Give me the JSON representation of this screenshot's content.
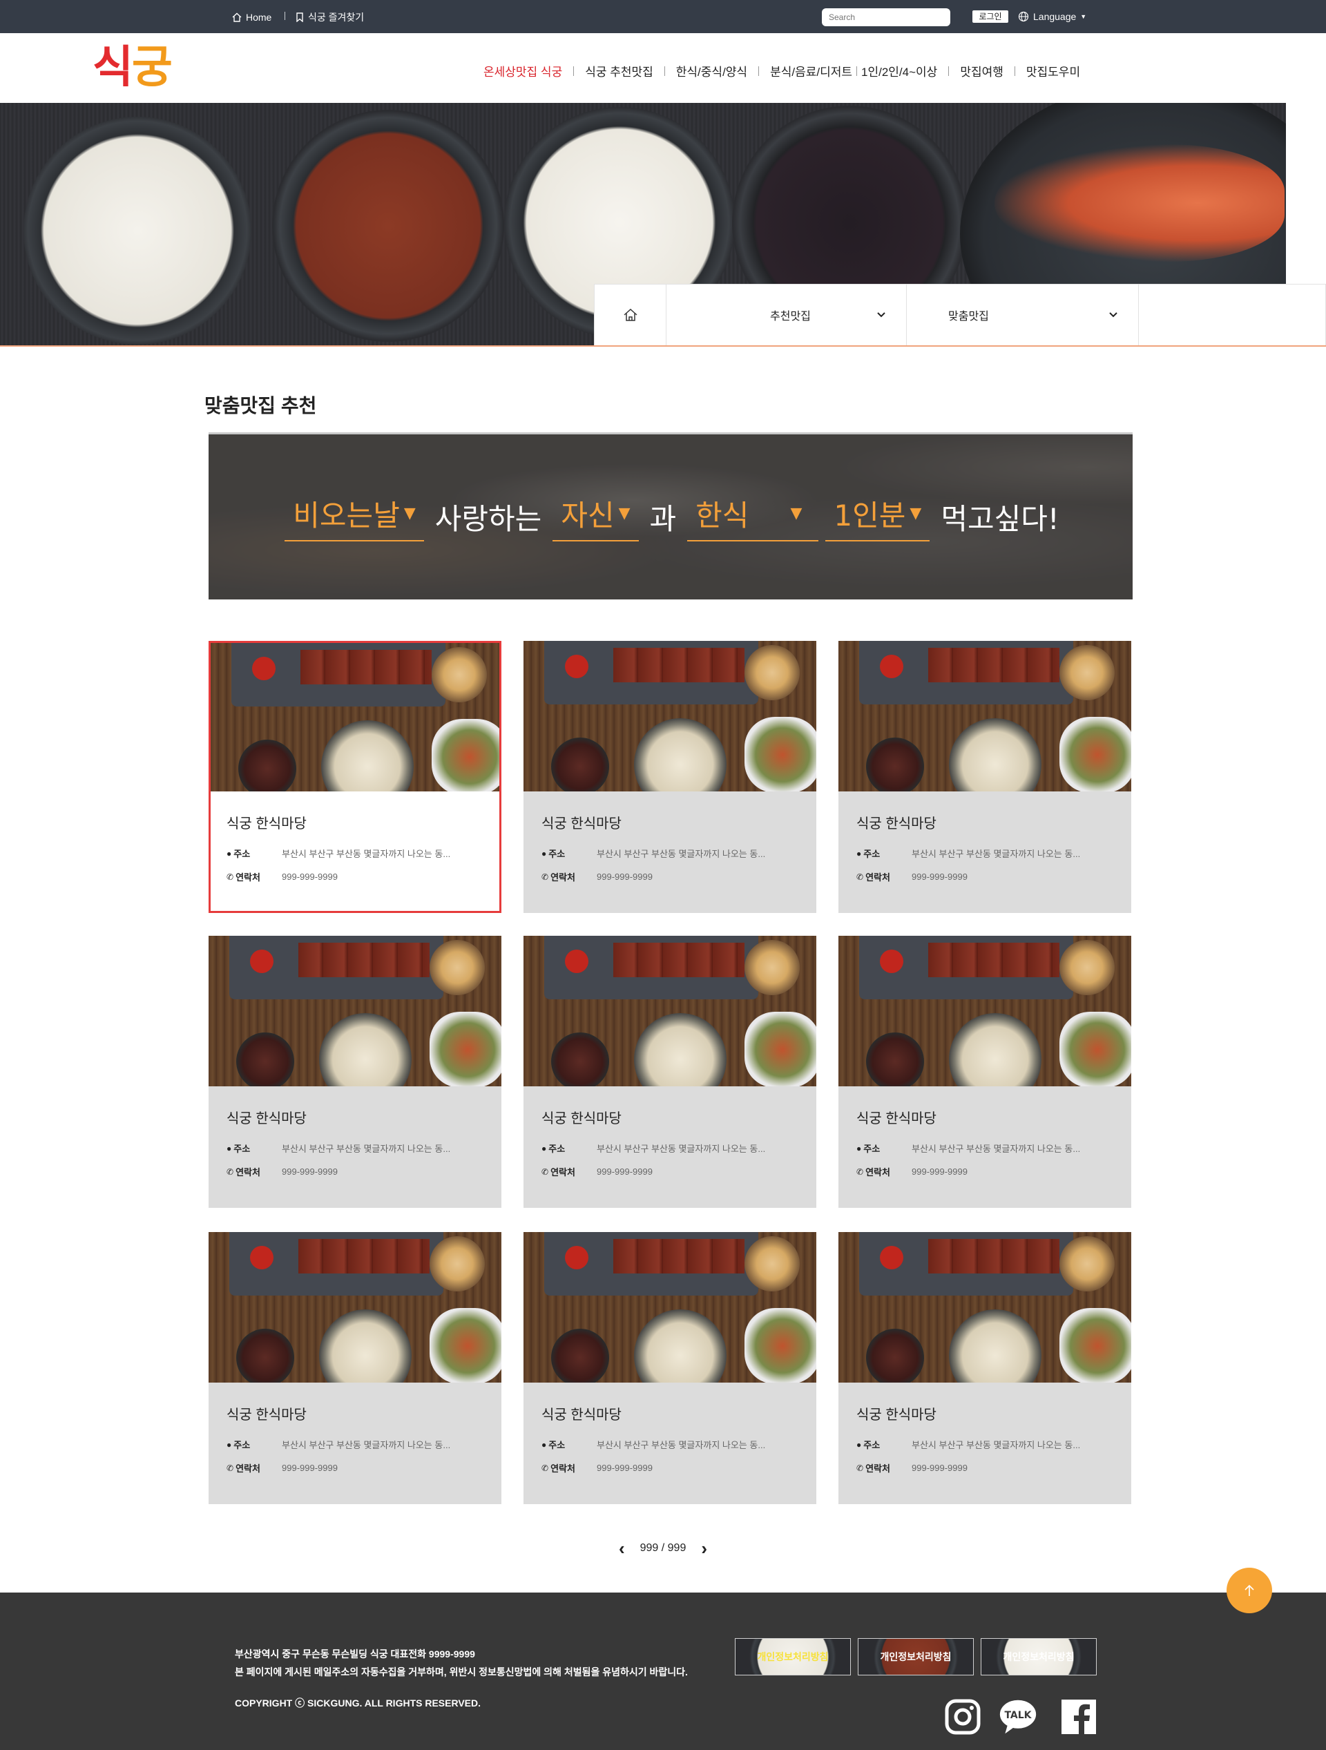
{
  "topbar": {
    "home_label": "Home",
    "favorite_label": "식궁 즐겨찾기",
    "search_placeholder": "Search",
    "login_label": "로그인",
    "language_label": "Language"
  },
  "header": {
    "logo_part1": "식",
    "logo_part2": "궁",
    "nav": [
      {
        "label": "온세상맛집 식궁",
        "active": true
      },
      {
        "label": "식궁 추천맛집"
      },
      {
        "label": "한식/중식/양식"
      },
      {
        "label": "분식/음료/디저트"
      },
      {
        "label": "1인/2인/4~이상"
      },
      {
        "label": "맛집여행"
      },
      {
        "label": "맛집도우미"
      }
    ]
  },
  "subbar": {
    "dropdown1": "추천맛집",
    "dropdown2": "맞춤맛집"
  },
  "section": {
    "title": "맞춤맛집 추천"
  },
  "selector": {
    "weather": "비오는날",
    "word1": "사랑하는",
    "companion": "자신",
    "word2": "과",
    "food": "한식",
    "people": "1인분",
    "ending": "먹고싶다!"
  },
  "cards": [
    {
      "name": "식궁 한식마당",
      "addr_label": "주소",
      "addr": "부산시 부산구 부산동 몇글자까지 나오는 동...",
      "tel_label": "연락처",
      "tel": "999-999-9999",
      "selected": true
    },
    {
      "name": "식궁 한식마당",
      "addr_label": "주소",
      "addr": "부산시 부산구 부산동 몇글자까지 나오는 동...",
      "tel_label": "연락처",
      "tel": "999-999-9999"
    },
    {
      "name": "식궁 한식마당",
      "addr_label": "주소",
      "addr": "부산시 부산구 부산동 몇글자까지 나오는 동...",
      "tel_label": "연락처",
      "tel": "999-999-9999"
    },
    {
      "name": "식궁 한식마당",
      "addr_label": "주소",
      "addr": "부산시 부산구 부산동 몇글자까지 나오는 동...",
      "tel_label": "연락처",
      "tel": "999-999-9999"
    },
    {
      "name": "식궁 한식마당",
      "addr_label": "주소",
      "addr": "부산시 부산구 부산동 몇글자까지 나오는 동...",
      "tel_label": "연락처",
      "tel": "999-999-9999"
    },
    {
      "name": "식궁 한식마당",
      "addr_label": "주소",
      "addr": "부산시 부산구 부산동 몇글자까지 나오는 동...",
      "tel_label": "연락처",
      "tel": "999-999-9999"
    },
    {
      "name": "식궁 한식마당",
      "addr_label": "주소",
      "addr": "부산시 부산구 부산동 몇글자까지 나오는 동...",
      "tel_label": "연락처",
      "tel": "999-999-9999"
    },
    {
      "name": "식궁 한식마당",
      "addr_label": "주소",
      "addr": "부산시 부산구 부산동 몇글자까지 나오는 동...",
      "tel_label": "연락처",
      "tel": "999-999-9999"
    },
    {
      "name": "식궁 한식마당",
      "addr_label": "주소",
      "addr": "부산시 부산구 부산동 몇글자까지 나오는 동...",
      "tel_label": "연락처",
      "tel": "999-999-9999"
    }
  ],
  "pager": {
    "text": "999 / 999"
  },
  "footer": {
    "address_line": "부산광역시 중구 무슨동 무슨빌딩  식궁   대표전화 9999-9999",
    "notice_line": "본 페이지에 게시된 메일주소의 자동수집을 거부하며, 위반시 정보통신망법에 의해 처벌됨을 유념하시기 바랍니다.",
    "copyright": "COPYRIGHT ⓒ SICKGUNG. ALL RIGHTS RESERVED.",
    "buttons": [
      "개인정보처리방침",
      "개인정보처리방침",
      "개인정보처리방침"
    ],
    "talk_label": "TALK"
  },
  "colors": {
    "accent": "#f4a03a",
    "brand_red": "#e32b2e",
    "nav_active": "#d9242c",
    "topbar": "#353c47",
    "footer": "#383838",
    "selected_border": "#e63c3c"
  },
  "icons": [
    "home-icon",
    "bookmark-icon",
    "globe-icon",
    "chevron-down-icon",
    "map-pin-icon",
    "phone-icon",
    "chevron-left-icon",
    "chevron-right-icon",
    "arrow-up-icon",
    "instagram-icon",
    "kakaotalk-icon",
    "facebook-icon"
  ]
}
